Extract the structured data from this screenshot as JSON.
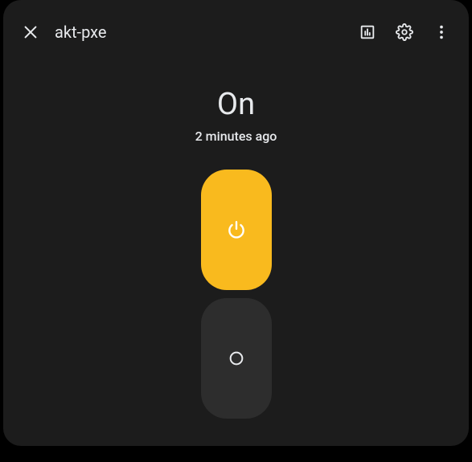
{
  "header": {
    "title": "akt-pxe"
  },
  "status": {
    "state": "On",
    "time": "2 minutes ago"
  },
  "colors": {
    "accent": "#f9ba1e"
  },
  "icons": {
    "close": "close-icon",
    "chart": "chart-icon",
    "settings": "gear-icon",
    "more": "more-vert-icon",
    "power": "power-icon",
    "circle": "circle-icon"
  }
}
